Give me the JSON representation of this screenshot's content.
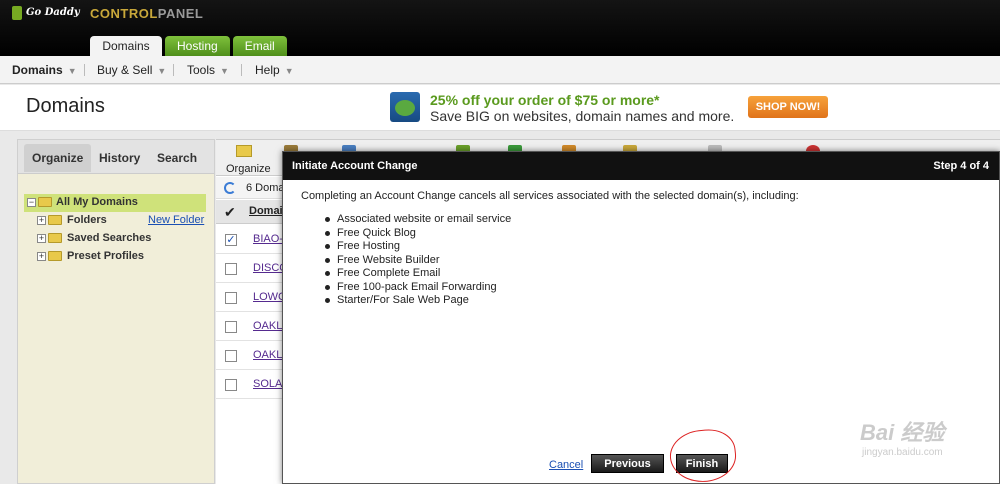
{
  "brand": {
    "logo_text": "Go Daddy",
    "product_a": "CONTROL",
    "product_b": "PANEL"
  },
  "tabs": [
    {
      "label": "Domains"
    },
    {
      "label": "Hosting"
    },
    {
      "label": "Email"
    }
  ],
  "menu": [
    {
      "label": "Domains"
    },
    {
      "label": "Buy & Sell"
    },
    {
      "label": "Tools"
    },
    {
      "label": "Help"
    }
  ],
  "page": {
    "title": "Domains"
  },
  "promo": {
    "headline": "25% off your order of $75 or more*",
    "subline": "Save BIG on websites, domain names and more.",
    "button": "SHOP NOW!"
  },
  "left_panel": {
    "tabs": [
      {
        "label": "Organize"
      },
      {
        "label": "History"
      },
      {
        "label": "Search"
      }
    ],
    "tree": [
      {
        "label": "All My Domains"
      },
      {
        "label": "Folders"
      },
      {
        "label": "Saved Searches"
      },
      {
        "label": "Preset Profiles"
      }
    ],
    "new_folder": "New Folder"
  },
  "grid": {
    "toolbar_organize": "Organize",
    "count_text": "6 Doma",
    "column_domain": "Domai",
    "rows": [
      {
        "name": "BIAO-",
        "checked": true
      },
      {
        "name": "DISCO",
        "checked": false
      },
      {
        "name": "LOWC",
        "checked": false
      },
      {
        "name": "OAKL",
        "checked": false
      },
      {
        "name": "OAKL",
        "checked": false
      },
      {
        "name": "SOLA",
        "checked": false
      }
    ]
  },
  "modal": {
    "title": "Initiate Account Change",
    "step": "Step 4 of 4",
    "intro": "Completing an Account Change cancels all services associated with the selected domain(s), including:",
    "items": [
      "Associated website or email service",
      "Free Quick Blog",
      "Free Hosting",
      "Free Website Builder",
      "Free Complete Email",
      "Free 100-pack Email Forwarding",
      "Starter/For Sale Web Page"
    ],
    "cancel": "Cancel",
    "previous": "Previous",
    "finish": "Finish"
  },
  "watermark": {
    "main": "Bai 经验",
    "sub": "jingyan.baidu.com"
  },
  "colors": {
    "green_tab": "#5ea624",
    "promo_green": "#5a9a1e",
    "shop_orange": "#ee8a28",
    "link_blue": "#1a4fb3",
    "tree_selected": "#cfe27a"
  }
}
